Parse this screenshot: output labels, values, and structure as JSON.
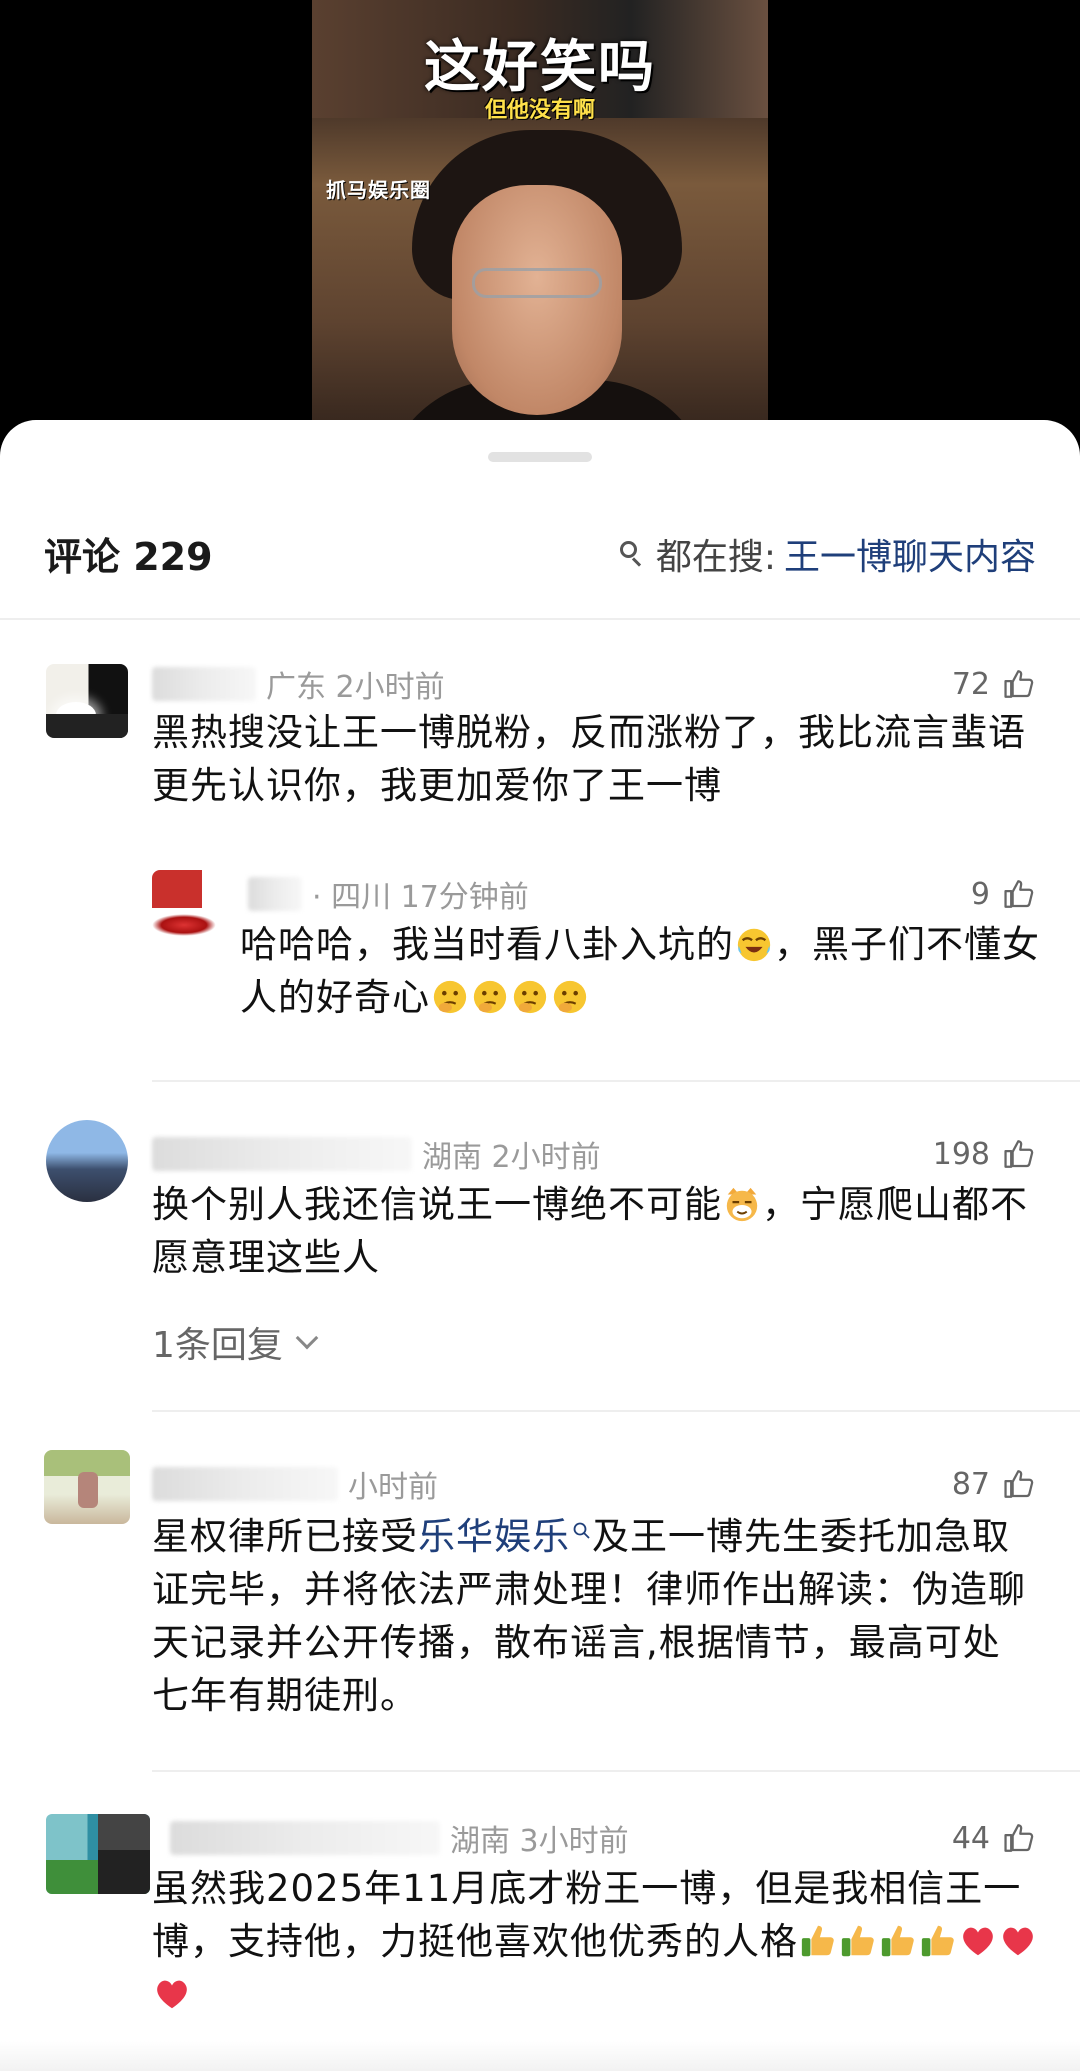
{
  "video": {
    "caption_main": "这好笑吗",
    "caption_sub": "但他没有啊",
    "watermark": "抓马娱乐圈"
  },
  "comments_panel": {
    "title": "评论 229",
    "hot_search_label": "都在搜:",
    "hot_search_term": "王一博聊天内容"
  },
  "comments": [
    {
      "location_time": "广东 2小时前",
      "likes": "72",
      "text": "黑热搜没让王一博脱粉，反而涨粉了，我比流言蜚语更先认识你，我更加爱你了王一博"
    },
    {
      "location_time": "· 四川 17分钟前",
      "likes": "9",
      "text_a": "哈哈哈，我当时看八卦入坑的",
      "text_b": "，黑子们不懂女人的好奇心"
    },
    {
      "location_time": "湖南 2小时前",
      "likes": "198",
      "text_a": "换个别人我还信说王一博绝不可能",
      "text_b": "，宁愿爬山都不愿意理这些人",
      "replies": "1条回复"
    },
    {
      "location_time": "小时前",
      "likes": "87",
      "text_a": "星权律所已接受",
      "link": "乐华娱乐",
      "text_b": "及王一博先生委托加急取证完毕，并将依法严肃处理！律师作出解读：伪造聊天记录并公开传播，散布谣言,根据情节，最高可处七年有期徒刑。"
    },
    {
      "location_time": "湖南 3小时前",
      "likes": "44",
      "text": "虽然我2025年11月底才粉王一博，但是我相信王一博，支持他，力挺他喜欢他优秀的人格"
    }
  ],
  "icons": {
    "like": "thumb-up-outline-icon",
    "search": "search-icon",
    "emoji_laugh": "laughing-tears-emoji",
    "emoji_think": "thinking-emoji",
    "emoji_cat": "smug-cat-emoji",
    "emoji_thumb": "thumbs-up-emoji",
    "emoji_heart": "red-heart-emoji"
  },
  "colors": {
    "link": "#1f3f7a",
    "caption_sub": "#ffe14a"
  }
}
